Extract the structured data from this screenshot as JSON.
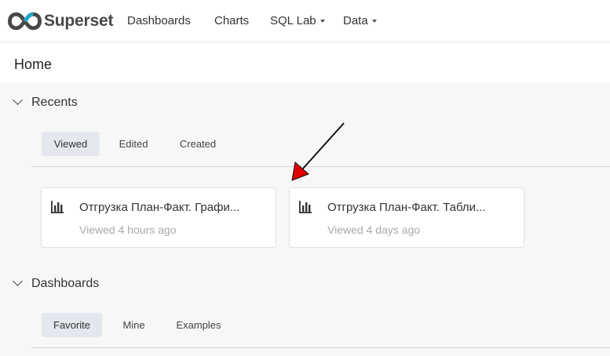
{
  "navbar": {
    "brand": "Superset",
    "items": [
      {
        "label": "Dashboards",
        "has_dropdown": false
      },
      {
        "label": "Charts",
        "has_dropdown": false
      },
      {
        "label": "SQL Lab",
        "has_dropdown": true
      },
      {
        "label": "Data",
        "has_dropdown": true
      }
    ]
  },
  "page": {
    "title": "Home"
  },
  "recents": {
    "title": "Recents",
    "expanded": true,
    "tabs": [
      {
        "label": "Viewed",
        "active": true
      },
      {
        "label": "Edited",
        "active": false
      },
      {
        "label": "Created",
        "active": false
      }
    ],
    "cards": [
      {
        "title": "Отгрузка План-Факт. Графи...",
        "meta": "Viewed 4 hours ago",
        "icon": "bar-chart-icon"
      },
      {
        "title": "Отгрузка План-Факт. Табли...",
        "meta": "Viewed 4 days ago",
        "icon": "bar-chart-icon"
      }
    ]
  },
  "dashboards": {
    "title": "Dashboards",
    "expanded": true,
    "tabs": [
      {
        "label": "Favorite",
        "active": true
      },
      {
        "label": "Mine",
        "active": false
      },
      {
        "label": "Examples",
        "active": false
      }
    ]
  },
  "annotation": {
    "type": "arrow",
    "color": "#e00000",
    "points_to": "recents-card-2"
  },
  "colors": {
    "logo_dark": "#484848",
    "logo_accent": "#20a7c9",
    "active_tab_bg": "#e4e8ee",
    "meta_text": "#a9a9a9"
  }
}
